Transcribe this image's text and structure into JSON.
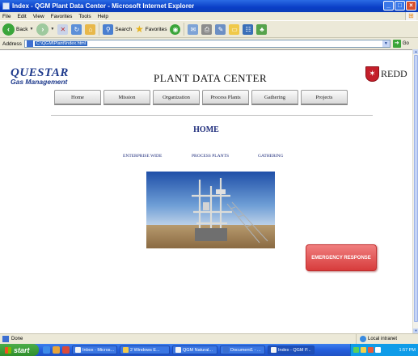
{
  "window": {
    "title": "Index - QGM Plant Data Center - Microsoft Internet Explorer",
    "controls": [
      "_",
      "□",
      "×"
    ]
  },
  "menu": [
    "File",
    "Edit",
    "View",
    "Favorites",
    "Tools",
    "Help"
  ],
  "toolbar": {
    "back_label": "Back",
    "search_label": "Search",
    "favorites_label": "Favorites"
  },
  "address": {
    "label": "Address",
    "url": "C:\\QGM\\Plant\\Index.html",
    "go_label": "Go"
  },
  "page": {
    "logo_line1": "QUESTAR",
    "logo_line2": "Gas Management",
    "site_title": "PLANT DATA CENTER",
    "partner_logo": "REDD",
    "nav_tabs": [
      "Home",
      "Mission",
      "Organization",
      "Process Plants",
      "Gathering",
      "Projects"
    ],
    "heading": "HOME",
    "sub_links": [
      "ENTERPRISE WIDE",
      "PROCESS PLANTS",
      "GATHERING"
    ],
    "emergency_button": "EMERGENCY RESPONSE"
  },
  "statusbar": {
    "status": "Done",
    "zone": "Local intranet"
  },
  "taskbar": {
    "start_label": "start",
    "tasks": [
      "Inbox - Micros...",
      "2 Windows E...",
      "QGM Natural...",
      "Document1 - ...",
      "Index - QGM P..."
    ],
    "clock": "1:57 PM"
  },
  "colors": {
    "brand_blue": "#1e3a8c",
    "heading_blue": "#1c2a7a",
    "emergency_red": "#d73c3c"
  }
}
